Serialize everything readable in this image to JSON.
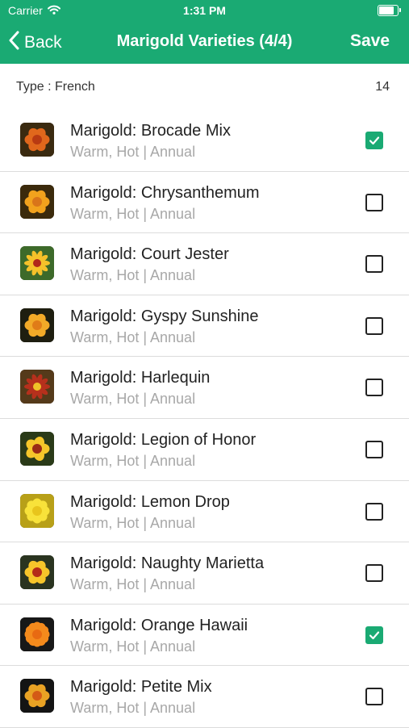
{
  "status": {
    "carrier": "Carrier",
    "time": "1:31 PM"
  },
  "nav": {
    "back_label": "Back",
    "title": "Marigold Varieties (4/4)",
    "save_label": "Save"
  },
  "summary": {
    "type_label": "Type : French",
    "count": "14"
  },
  "colors": {
    "accent": "#1aaa73"
  },
  "items": [
    {
      "name": "Marigold: Brocade Mix",
      "subtitle": "Warm, Hot | Annual",
      "checked": true,
      "thumb": "brocade"
    },
    {
      "name": "Marigold: Chrysanthemum",
      "subtitle": "Warm, Hot | Annual",
      "checked": false,
      "thumb": "chrysanthemum"
    },
    {
      "name": "Marigold: Court Jester",
      "subtitle": "Warm, Hot | Annual",
      "checked": false,
      "thumb": "jester"
    },
    {
      "name": "Marigold: Gyspy Sunshine",
      "subtitle": "Warm, Hot | Annual",
      "checked": false,
      "thumb": "gypsy"
    },
    {
      "name": "Marigold: Harlequin",
      "subtitle": "Warm, Hot | Annual",
      "checked": false,
      "thumb": "harlequin"
    },
    {
      "name": "Marigold: Legion of Honor",
      "subtitle": "Warm, Hot | Annual",
      "checked": false,
      "thumb": "legion"
    },
    {
      "name": "Marigold: Lemon Drop",
      "subtitle": "Warm, Hot | Annual",
      "checked": false,
      "thumb": "lemon"
    },
    {
      "name": "Marigold: Naughty Marietta",
      "subtitle": "Warm, Hot | Annual",
      "checked": false,
      "thumb": "marietta"
    },
    {
      "name": "Marigold: Orange Hawaii",
      "subtitle": "Warm, Hot | Annual",
      "checked": true,
      "thumb": "hawaii"
    },
    {
      "name": "Marigold: Petite Mix",
      "subtitle": "Warm, Hot | Annual",
      "checked": false,
      "thumb": "petite"
    }
  ]
}
